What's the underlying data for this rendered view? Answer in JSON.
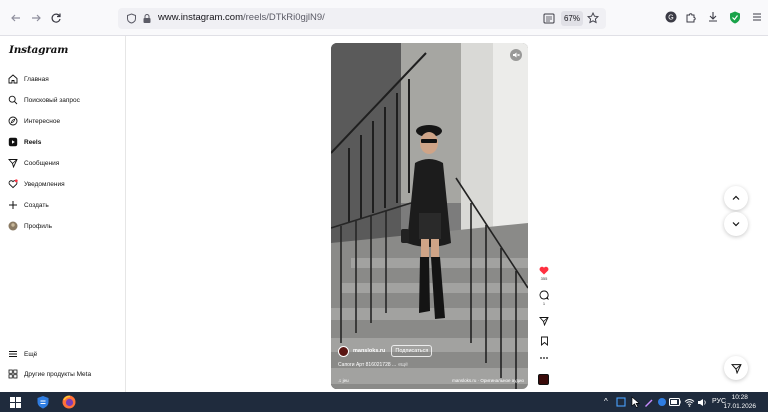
{
  "browser": {
    "url_domain": "www.instagram.com",
    "url_path": "/reels/DTkRi0gjlN9/",
    "zoom": "67%"
  },
  "sidebar": {
    "logo": "Instagram",
    "items": [
      {
        "label": "Главная"
      },
      {
        "label": "Поисковый запрос"
      },
      {
        "label": "Интересное"
      },
      {
        "label": "Reels"
      },
      {
        "label": "Сообщения"
      },
      {
        "label": "Уведомления"
      },
      {
        "label": "Создать"
      },
      {
        "label": "Профиль"
      }
    ],
    "bottom": [
      {
        "label": "Ещё"
      },
      {
        "label": "Другие продукты Meta"
      }
    ]
  },
  "reel": {
    "author": "mansloks.ru",
    "subscribe_label": "Подписаться",
    "caption": "Сапоги Арт 816021728 ...",
    "caption_more": "ещё",
    "audio_left": "jeu",
    "audio_right": "mansloks.ru · Оригинальное аудио",
    "likes": "355",
    "comments": "1"
  },
  "taskbar": {
    "lang": "РУС",
    "time": "10:28",
    "date": "17.01.2026"
  }
}
